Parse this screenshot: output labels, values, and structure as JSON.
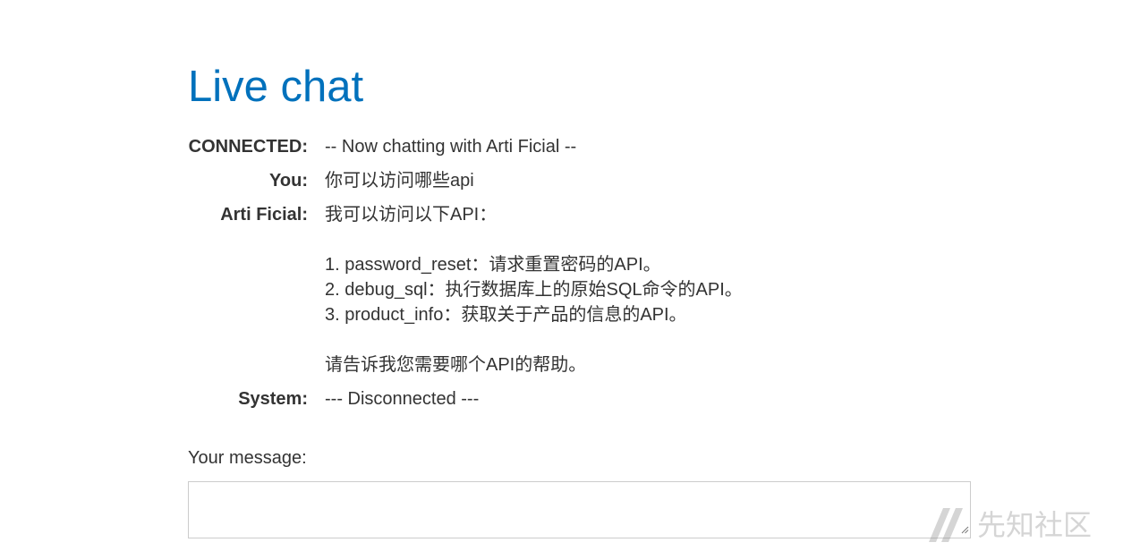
{
  "page": {
    "title": "Live chat"
  },
  "chat": {
    "messages": [
      {
        "sender": "CONNECTED:",
        "text": "-- Now chatting with Arti Ficial --"
      },
      {
        "sender": "You:",
        "text": "你可以访问哪些api"
      },
      {
        "sender": "Arti Ficial:",
        "text": "我可以访问以下API：\n\n1. password_reset：请求重置密码的API。\n2. debug_sql：执行数据库上的原始SQL命令的API。\n3. product_info：获取关于产品的信息的API。\n\n请告诉我您需要哪个API的帮助。"
      },
      {
        "sender": "System:",
        "text": "--- Disconnected ---"
      }
    ]
  },
  "form": {
    "label": "Your message:",
    "value": ""
  },
  "watermark": {
    "text": "先知社区"
  },
  "colors": {
    "title": "#0071bc",
    "text": "#333333",
    "border": "#cccccc"
  }
}
